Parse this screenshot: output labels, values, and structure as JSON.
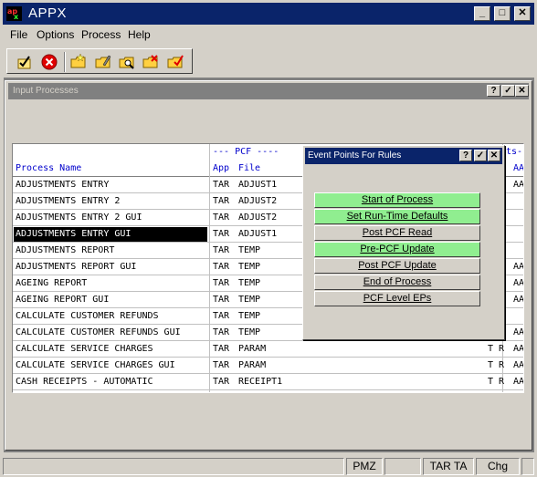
{
  "window": {
    "title": "APPX"
  },
  "menu": [
    "File",
    "Options",
    "Process",
    "Help"
  ],
  "toolbar": [
    {
      "icon": "checkmark-document-icon"
    },
    {
      "icon": "cancel-red-circle-icon"
    },
    {
      "icon": "folder-new-icon"
    },
    {
      "icon": "folder-edit-icon"
    },
    {
      "icon": "folder-view-icon"
    },
    {
      "icon": "folder-delete-icon"
    },
    {
      "icon": "folder-check-icon"
    }
  ],
  "child": {
    "title": "Input Processes"
  },
  "grid": {
    "header": {
      "pcf_group": "--- PCF ----",
      "process_name": "Process Name",
      "app": "App",
      "file": "File",
      "ts_group": "ts-",
      "aa": "AA"
    },
    "rows": [
      {
        "name": "ADJUSTMENTS ENTRY",
        "app": "TAR",
        "file": "ADJUST1",
        "t": "",
        "aa": "AA"
      },
      {
        "name": "ADJUSTMENTS ENTRY 2",
        "app": "TAR",
        "file": "ADJUST2",
        "t": "",
        "aa": ""
      },
      {
        "name": "ADJUSTMENTS ENTRY 2 GUI",
        "app": "TAR",
        "file": "ADJUST2",
        "t": "",
        "aa": ""
      },
      {
        "name": "ADJUSTMENTS ENTRY GUI",
        "app": "TAR",
        "file": "ADJUST1",
        "t": "",
        "aa": "",
        "selected": true
      },
      {
        "name": "ADJUSTMENTS REPORT",
        "app": "TAR",
        "file": "TEMP",
        "t": "",
        "aa": ""
      },
      {
        "name": "ADJUSTMENTS REPORT GUI",
        "app": "TAR",
        "file": "TEMP",
        "t": "",
        "aa": "AA"
      },
      {
        "name": "AGEING REPORT",
        "app": "TAR",
        "file": "TEMP",
        "t": "",
        "aa": "AA"
      },
      {
        "name": "AGEING REPORT GUI",
        "app": "TAR",
        "file": "TEMP",
        "t": "",
        "aa": "AA"
      },
      {
        "name": "CALCULATE CUSTOMER REFUNDS",
        "app": "TAR",
        "file": "TEMP",
        "t": "",
        "aa": ""
      },
      {
        "name": "CALCULATE CUSTOMER REFUNDS GUI",
        "app": "TAR",
        "file": "TEMP",
        "t": "",
        "aa": "AA"
      },
      {
        "name": "CALCULATE SERVICE CHARGES",
        "app": "TAR",
        "file": "PARAM",
        "t": "T R",
        "aa": "AA"
      },
      {
        "name": "CALCULATE SERVICE CHARGES GUI",
        "app": "TAR",
        "file": "PARAM",
        "t": "T R",
        "aa": "AA"
      },
      {
        "name": "CASH RECEIPTS - AUTOMATIC",
        "app": "TAR",
        "file": "RECEIPT1",
        "t": "T R",
        "aa": "AA"
      }
    ]
  },
  "popup": {
    "title": "Event Points For Rules",
    "buttons": [
      {
        "label": "Start of Process",
        "color": "#90ee90"
      },
      {
        "label": "Set Run-Time Defaults",
        "color": "#90ee90"
      },
      {
        "label": "Post PCF Read",
        "color": "#d4d0c8"
      },
      {
        "label": "Pre-PCF Update",
        "color": "#90ee90"
      },
      {
        "label": "Post PCF Update",
        "color": "#d4d0c8"
      },
      {
        "label": "End of Process",
        "color": "#d4d0c8"
      },
      {
        "label": "PCF Level EPs",
        "color": "#d4d0c8"
      }
    ]
  },
  "status": [
    "PMZ",
    "TAR TA",
    "Chg"
  ]
}
